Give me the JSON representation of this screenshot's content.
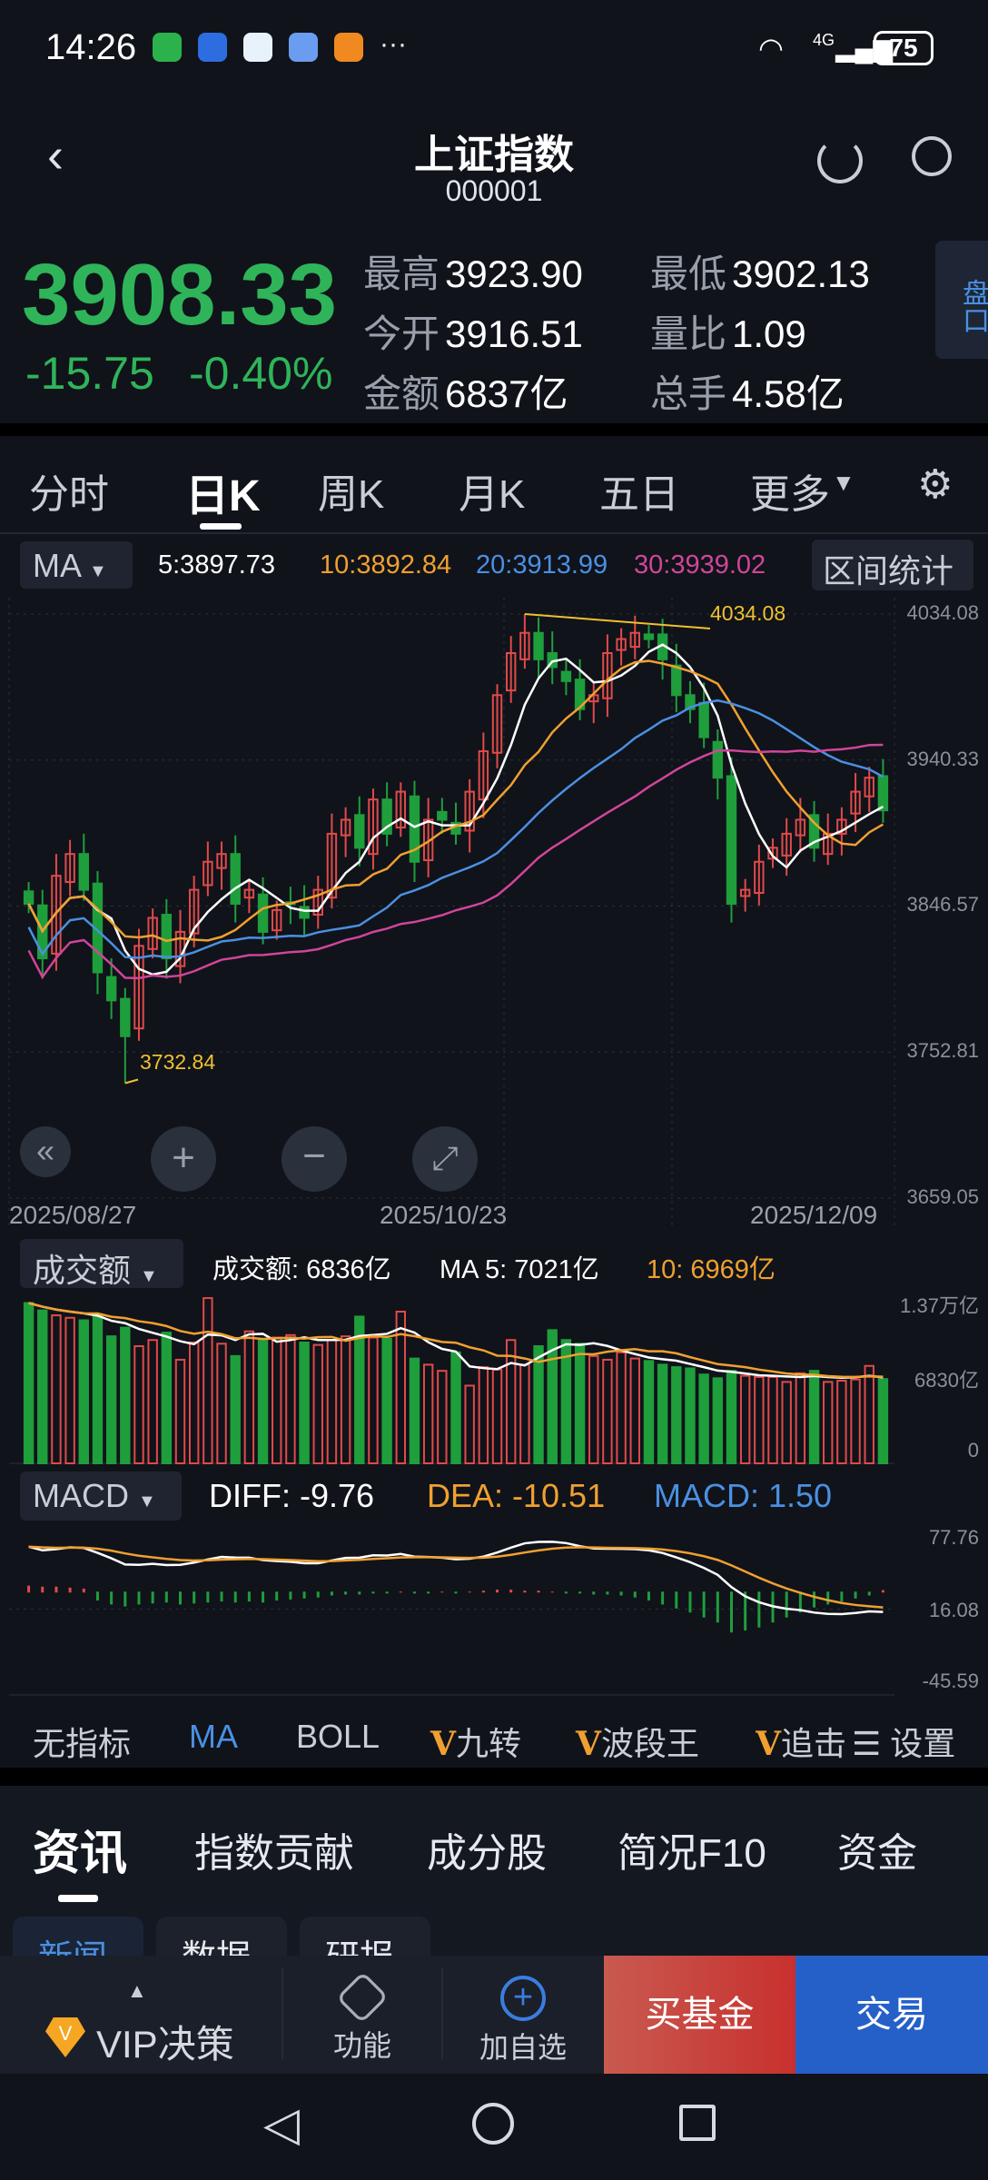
{
  "status_bar": {
    "time": "14:26",
    "network": "4G",
    "battery": "75",
    "more": "···"
  },
  "header": {
    "title": "上证指数",
    "code": "000001"
  },
  "quote": {
    "price": "3908.33",
    "change": "-15.75",
    "change_pct": "-0.40%",
    "stats": [
      {
        "label": "最高",
        "value": "3923.90"
      },
      {
        "label": "最低",
        "value": "3902.13"
      },
      {
        "label": "今开",
        "value": "3916.51"
      },
      {
        "label": "量比",
        "value": "1.09"
      },
      {
        "label": "金额",
        "value": "6837亿"
      },
      {
        "label": "总手",
        "value": "4.58亿"
      }
    ],
    "side_button": "盘口"
  },
  "period_tabs": [
    "分时",
    "日K",
    "周K",
    "月K",
    "五日",
    "更多"
  ],
  "active_period": "日K",
  "ma_bar": {
    "selector": "MA",
    "ma5": "5:3897.73",
    "ma10": "10:3892.84",
    "ma20": "20:3913.99",
    "ma30": "30:3939.02",
    "range_stats": "区间统计"
  },
  "colors": {
    "up": "#e04a4a",
    "down": "#1f9e3c",
    "ma5": "#ffffff",
    "ma10": "#f0a030",
    "ma20": "#4a90e2",
    "ma30": "#d0459a",
    "accent": "#4a90e2"
  },
  "chart_data": [
    {
      "type": "candlestick",
      "title": "日K",
      "y_ticks": [
        "4034.08",
        "3940.33",
        "3846.57",
        "3752.81",
        "3659.05"
      ],
      "ylim": [
        3659.05,
        4034.08
      ],
      "x_ticks": [
        "2025/08/27",
        "2025/10/23",
        "2025/12/09"
      ],
      "annotations": {
        "high": "4034.08",
        "low": "3732.84"
      },
      "closes": [
        3848,
        3813,
        3866,
        3880,
        3857,
        3804,
        3786,
        3763,
        3821,
        3839,
        3813,
        3830,
        3857,
        3875,
        3880,
        3848,
        3857,
        3830,
        3844,
        3848,
        3839,
        3857,
        3893,
        3902,
        3884,
        3915,
        3893,
        3920,
        3875,
        3902,
        3902,
        3893,
        3920,
        3946,
        3982,
        4009,
        4022,
        4005,
        4000,
        3991,
        3973,
        3982,
        4009,
        4018,
        4022,
        4018,
        4005,
        3982,
        3973,
        3955,
        3929,
        3848,
        3857,
        3875,
        3884,
        3893,
        3902,
        3884,
        3893,
        3902,
        3920,
        3929,
        3908
      ]
    },
    {
      "type": "bar",
      "title": "成交额",
      "header": {
        "selector": "成交额",
        "value": "成交额: 6836亿",
        "ma5": "MA 5: 7021亿",
        "ma10": "10: 6969亿"
      },
      "y_ticks": [
        "1.37万亿",
        "6830亿",
        "0"
      ],
      "ylim": [
        0,
        13700
      ],
      "values": [
        13000,
        12400,
        12000,
        11800,
        11600,
        12100,
        10300,
        11000,
        9500,
        10000,
        10600,
        8400,
        9800,
        13400,
        9700,
        8700,
        10700,
        10000,
        10200,
        10400,
        9800,
        9600,
        10000,
        10300,
        11900,
        10200,
        10100,
        12300,
        8500,
        8000,
        7500,
        9000,
        6300,
        7800,
        7600,
        10000,
        8000,
        9500,
        10800,
        10000,
        9700,
        8700,
        8400,
        9000,
        8500,
        8300,
        8000,
        7800,
        7700,
        7200,
        6900,
        7500,
        7100,
        7000,
        7000,
        6600,
        7300,
        7500,
        6600,
        6700,
        6800,
        7900,
        6836
      ]
    },
    {
      "type": "bar",
      "title": "MACD",
      "header": {
        "selector": "MACD",
        "diff": "DIFF: -9.76",
        "dea": "DEA: -10.51",
        "macd": "MACD: 1.50"
      },
      "y_ticks": [
        "77.76",
        "16.08",
        "-45.59"
      ],
      "ylim": [
        -45.59,
        77.76
      ],
      "values": [
        6,
        5,
        5,
        4,
        3,
        -8,
        -12,
        -14,
        -12,
        -11,
        -10,
        -12,
        -11,
        -10,
        -9,
        -10,
        -9,
        -10,
        -8,
        -7,
        -6,
        -5,
        -3,
        -2,
        -2,
        -1,
        -1,
        0,
        -1,
        -1,
        0,
        -1,
        0,
        1,
        2,
        2,
        1,
        1,
        0,
        -1,
        -1,
        -2,
        -2,
        -3,
        -5,
        -8,
        -12,
        -16,
        -20,
        -25,
        -30,
        -40,
        -38,
        -35,
        -30,
        -25,
        -20,
        -15,
        -12,
        -9,
        -6,
        -3,
        1.5
      ]
    }
  ],
  "chart_controls": [
    "scroll-left",
    "zoom-in",
    "zoom-out",
    "fullscreen"
  ],
  "indicator_tabs": [
    "无指标",
    "MA",
    "BOLL",
    "九转",
    "波段王",
    "追击",
    "设置"
  ],
  "vip_mark": "V",
  "info_tabs": [
    "资讯",
    "指数贡献",
    "成分股",
    "简况F10",
    "资金"
  ],
  "sub_tabs": [
    "新闻",
    "数据",
    "研报"
  ],
  "bottom_bar": {
    "vip": "VIP决策",
    "function": "功能",
    "add": "加自选",
    "buy_fund": "买基金",
    "trade": "交易"
  }
}
